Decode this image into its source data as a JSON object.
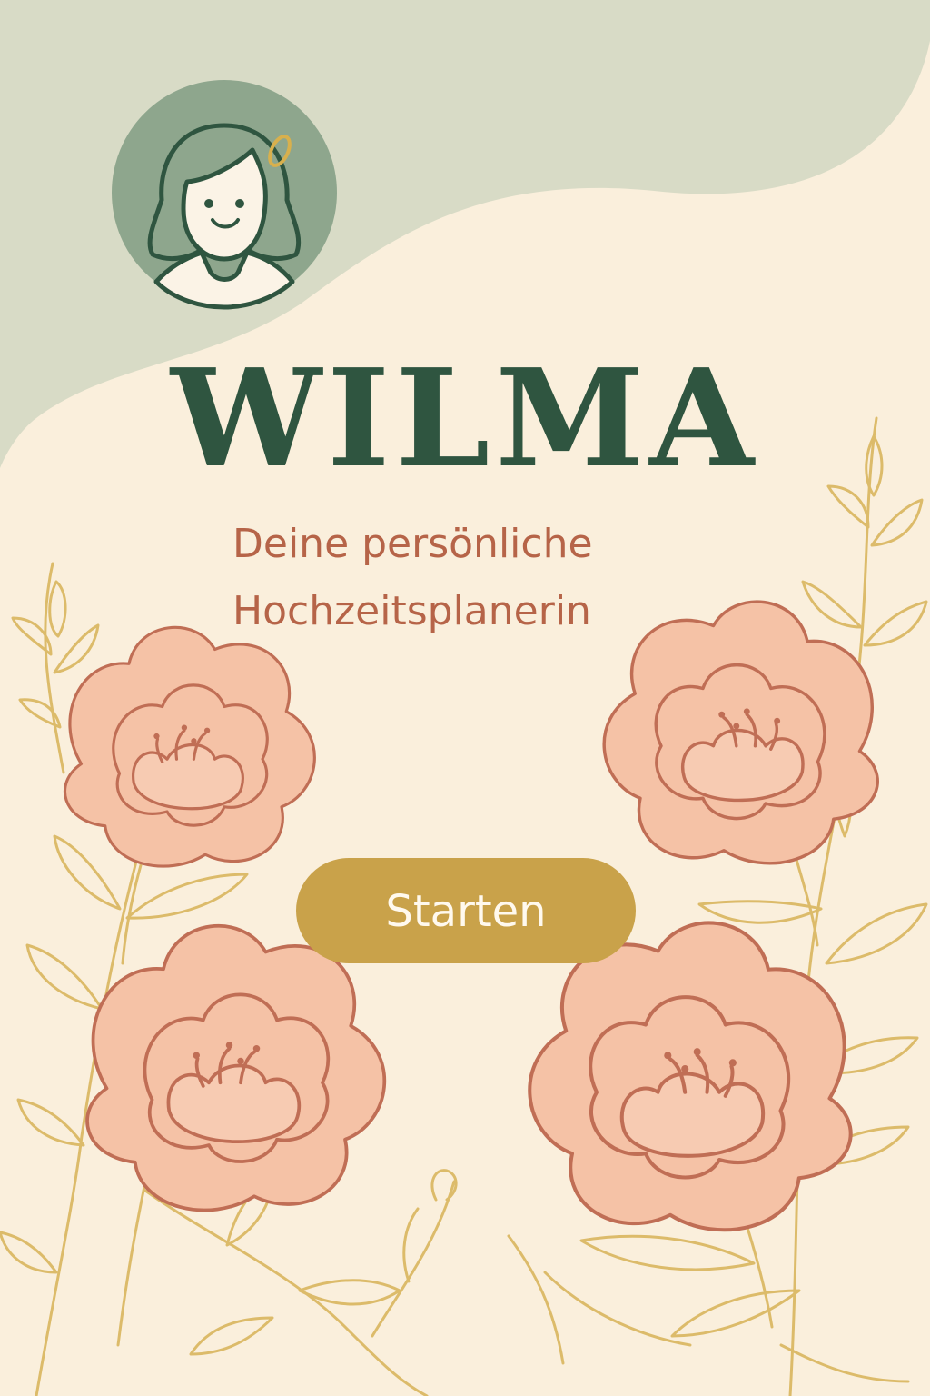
{
  "app": {
    "title": "WILMA",
    "subtitle": "Deine persönliche\nHochzeitsplanerin"
  },
  "actions": {
    "start_label": "Starten"
  },
  "icons": {
    "avatar": "woman-avatar-icon",
    "decoration": "peony-flower-icon"
  },
  "colors": {
    "background": "#faefdc",
    "header_wave": "#d8dbc6",
    "title": "#2f5540",
    "subtitle": "#b66448",
    "button": "#c9a24a",
    "button_text": "#fff9ee",
    "avatar_circle": "#8ea68d",
    "flower_fill": "#f5c2a6",
    "flower_stroke": "#c06e55",
    "leaf_stroke": "#dcbb6a"
  }
}
